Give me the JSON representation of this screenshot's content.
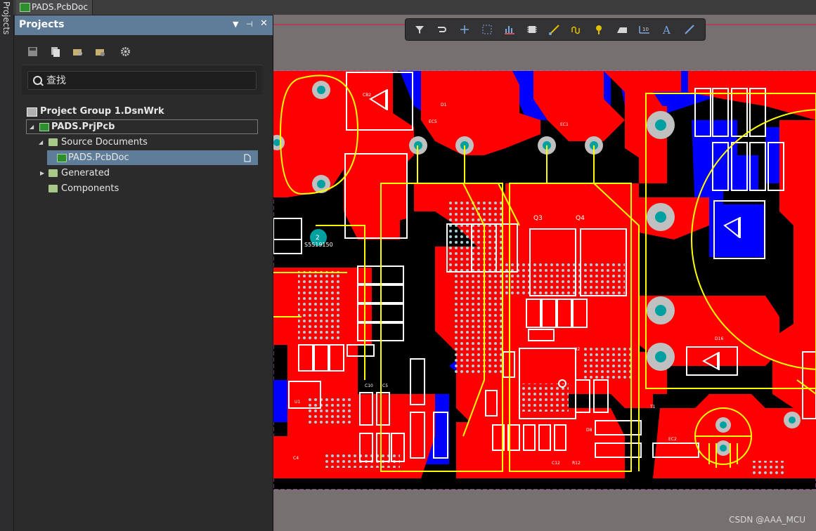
{
  "side_tab": {
    "label": "Projects"
  },
  "doc_tab": {
    "label": "PADS.PcbDoc"
  },
  "panel": {
    "title": "Projects",
    "search_placeholder": "查找",
    "tree": {
      "group": "Project Group 1.DsnWrk",
      "project": "PADS.PrjPcb",
      "source_docs": "Source Documents",
      "pcb_doc": "PADS.PcbDoc",
      "generated": "Generated",
      "components": "Components"
    }
  },
  "toolbar_icons": [
    "filter-icon",
    "route-icon",
    "cross-icon",
    "select-rect-icon",
    "chart-icon",
    "chip-icon",
    "interactive-route-icon",
    "diff-pair-icon",
    "place-via-icon",
    "fill-icon",
    "string-icon",
    "text-icon",
    "line-icon"
  ],
  "pcb": {
    "labels": {
      "ref_cb2": "CB2",
      "ref_d1": "D1",
      "ref_ec5": "EC5",
      "ref_ec1": "EC1",
      "ref_q3": "Q3",
      "ref_q4": "Q4",
      "ref_d16": "D16",
      "ref_ec2": "EC2",
      "ref_t1": "T1",
      "ref_c10": "C10",
      "ref_c5": "C5",
      "ref_u1": "U1",
      "ref_c4": "C4",
      "ref_u2": "U2",
      "ref_d8": "D8",
      "ref_c12": "C12",
      "ref_r12": "R12",
      "mark_2": "2",
      "mark_part": "S5S19150"
    }
  },
  "watermark": "CSDN @AAA_MCU",
  "colors": {
    "top_copper": "#ff0000",
    "bottom_copper": "#0000ff",
    "silk": "#ffffff",
    "outline": "#ffff00",
    "board": "#000000",
    "canvas": "#777070",
    "panel_header": "#5f7d99",
    "selected_row": "#5f7d99"
  }
}
